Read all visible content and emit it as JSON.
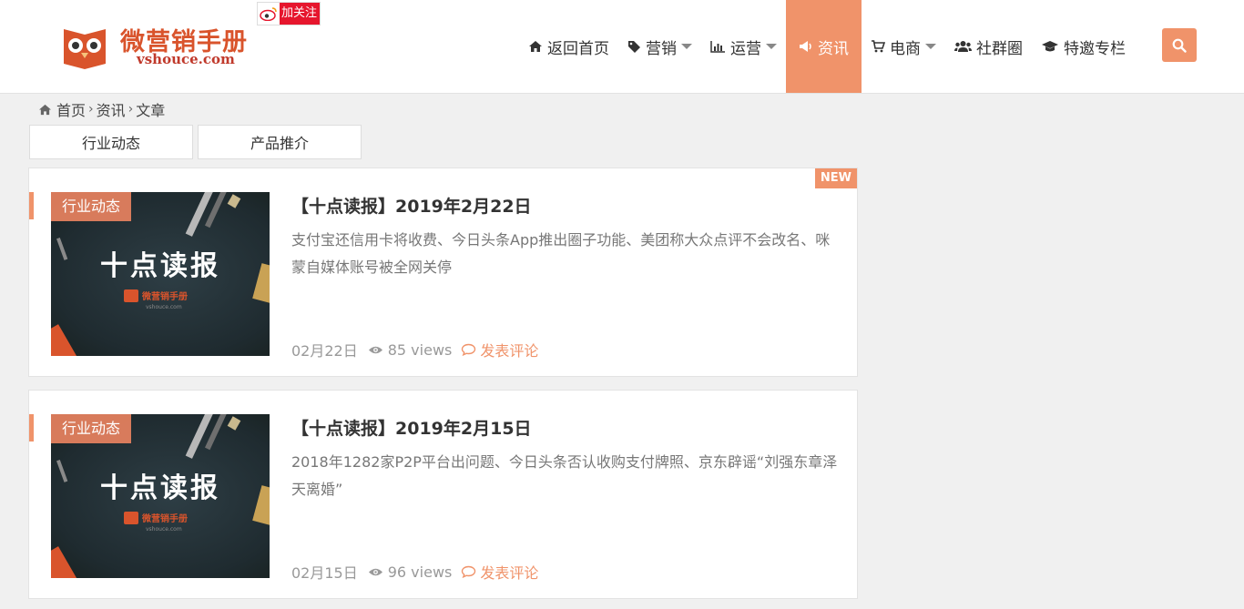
{
  "brand": {
    "title": "微营销手册",
    "subtitle": "vshouce.com",
    "follow_label": "加关注",
    "accent_color": "#f0936a",
    "logo_color": "#d9542c"
  },
  "nav": {
    "items": [
      {
        "label": "返回首页",
        "icon": "home-icon"
      },
      {
        "label": "营销",
        "icon": "tag-icon",
        "dropdown": true
      },
      {
        "label": "运营",
        "icon": "bar-chart-icon",
        "dropdown": true
      },
      {
        "label": "资讯",
        "icon": "megaphone-icon",
        "active": true
      },
      {
        "label": "电商",
        "icon": "cart-icon",
        "dropdown": true
      },
      {
        "label": "社群圈",
        "icon": "users-icon"
      },
      {
        "label": "特邀专栏",
        "icon": "graduation-cap-icon"
      }
    ],
    "search_icon": "search-icon"
  },
  "breadcrumb": [
    "首页",
    "资讯",
    "文章"
  ],
  "categories": [
    "行业动态",
    "产品推介"
  ],
  "articles": [
    {
      "badge": "NEW",
      "tag": "行业动态",
      "thumb_title": "十点读报",
      "thumb_logo": "微营销手册",
      "thumb_logo_sub": "vshouce.com",
      "title": "【十点读报】2019年2月22日",
      "excerpt": "支付宝还信用卡将收费、今日头条App推出圈子功能、美团称大众点评不会改名、咪蒙自媒体账号被全网关停",
      "date": "02月22日",
      "views": "85 views",
      "comment": "发表评论"
    },
    {
      "badge": "",
      "tag": "行业动态",
      "thumb_title": "十点读报",
      "thumb_logo": "微营销手册",
      "thumb_logo_sub": "vshouce.com",
      "title": "【十点读报】2019年2月15日",
      "excerpt": "2018年1282家P2P平台出问题、今日头条否认收购支付牌照、京东辟谣“刘强东章泽天离婚”",
      "date": "02月15日",
      "views": "96 views",
      "comment": "发表评论"
    }
  ]
}
